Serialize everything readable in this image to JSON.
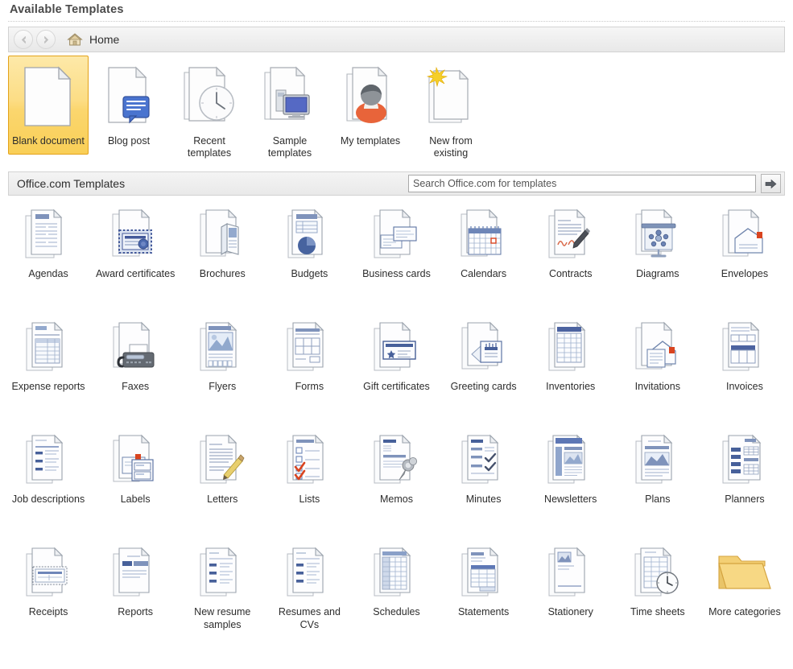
{
  "page_title": "Available Templates",
  "nav": {
    "back_label": "Back",
    "forward_label": "Forward",
    "home_label": "Home",
    "back_icon": "arrow-left-icon",
    "forward_icon": "arrow-right-icon",
    "home_icon": "house-icon"
  },
  "top_tiles": [
    {
      "label": "Blank document",
      "icon": "blank-document-icon",
      "selected": true
    },
    {
      "label": "Blog post",
      "icon": "blog-post-icon",
      "selected": false
    },
    {
      "label": "Recent templates",
      "icon": "recent-templates-clock-icon",
      "selected": false
    },
    {
      "label": "Sample templates",
      "icon": "sample-templates-monitor-icon",
      "selected": false
    },
    {
      "label": "My templates",
      "icon": "my-templates-person-icon",
      "selected": false
    },
    {
      "label": "New from existing",
      "icon": "new-from-existing-icon",
      "selected": false
    }
  ],
  "office_band": {
    "label": "Office.com Templates",
    "search_placeholder": "Search Office.com for templates",
    "search_value": "",
    "go_label": "Start searching",
    "go_icon": "arrow-right-go-icon"
  },
  "categories": [
    {
      "label": "Agendas",
      "icon": "agendas-icon"
    },
    {
      "label": "Award certificates",
      "icon": "award-certificates-icon"
    },
    {
      "label": "Brochures",
      "icon": "brochures-icon"
    },
    {
      "label": "Budgets",
      "icon": "budgets-icon"
    },
    {
      "label": "Business cards",
      "icon": "business-cards-icon"
    },
    {
      "label": "Calendars",
      "icon": "calendars-icon"
    },
    {
      "label": "Contracts",
      "icon": "contracts-icon"
    },
    {
      "label": "Diagrams",
      "icon": "diagrams-icon"
    },
    {
      "label": "Envelopes",
      "icon": "envelopes-icon"
    },
    {
      "label": "Expense reports",
      "icon": "expense-reports-icon"
    },
    {
      "label": "Faxes",
      "icon": "faxes-icon"
    },
    {
      "label": "Flyers",
      "icon": "flyers-icon"
    },
    {
      "label": "Forms",
      "icon": "forms-icon"
    },
    {
      "label": "Gift certificates",
      "icon": "gift-certificates-icon"
    },
    {
      "label": "Greeting cards",
      "icon": "greeting-cards-icon"
    },
    {
      "label": "Inventories",
      "icon": "inventories-icon"
    },
    {
      "label": "Invitations",
      "icon": "invitations-icon"
    },
    {
      "label": "Invoices",
      "icon": "invoices-icon"
    },
    {
      "label": "Job descriptions",
      "icon": "job-descriptions-icon"
    },
    {
      "label": "Labels",
      "icon": "labels-icon"
    },
    {
      "label": "Letters",
      "icon": "letters-icon"
    },
    {
      "label": "Lists",
      "icon": "lists-icon"
    },
    {
      "label": "Memos",
      "icon": "memos-icon"
    },
    {
      "label": "Minutes",
      "icon": "minutes-icon"
    },
    {
      "label": "Newsletters",
      "icon": "newsletters-icon"
    },
    {
      "label": "Plans",
      "icon": "plans-icon"
    },
    {
      "label": "Planners",
      "icon": "planners-icon"
    },
    {
      "label": "Receipts",
      "icon": "receipts-icon"
    },
    {
      "label": "Reports",
      "icon": "reports-icon"
    },
    {
      "label": "New resume samples",
      "icon": "new-resume-samples-icon"
    },
    {
      "label": "Resumes and CVs",
      "icon": "resumes-and-cvs-icon"
    },
    {
      "label": "Schedules",
      "icon": "schedules-icon"
    },
    {
      "label": "Statements",
      "icon": "statements-icon"
    },
    {
      "label": "Stationery",
      "icon": "stationery-icon"
    },
    {
      "label": "Time sheets",
      "icon": "time-sheets-icon"
    },
    {
      "label": "More categories",
      "icon": "folder-icon"
    }
  ],
  "colors": {
    "selection_fill": "#fbd66e",
    "selection_border": "#e3a21a",
    "icon_blue": "#4a6fa5",
    "icon_accent_red": "#d9441f",
    "folder_yellow": "#f2c45a",
    "band_background": "#eeeeee"
  }
}
